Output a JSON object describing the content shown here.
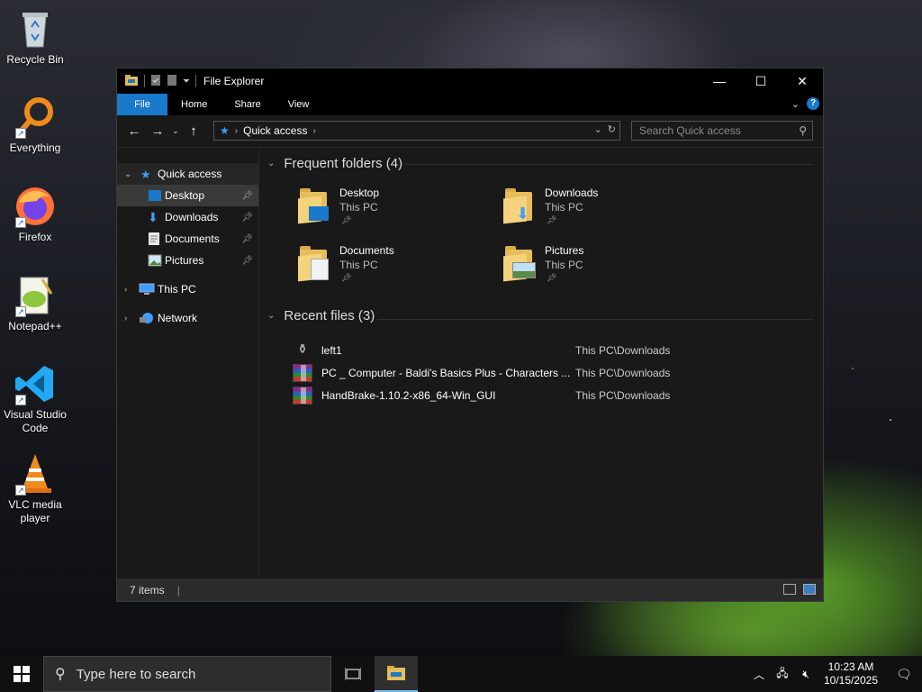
{
  "desktop": {
    "icons": [
      {
        "label": "Recycle Bin",
        "icon": "recycle-bin-icon"
      },
      {
        "label": "Everything",
        "icon": "everything-search-icon"
      },
      {
        "label": "Firefox",
        "icon": "firefox-icon"
      },
      {
        "label": "Notepad++",
        "icon": "notepad-plus-plus-icon"
      },
      {
        "label": "Visual Studio Code",
        "icon": "vscode-icon"
      },
      {
        "label": "VLC media player",
        "icon": "vlc-icon"
      }
    ]
  },
  "window": {
    "title": "File Explorer",
    "controls": {
      "minimize": "—",
      "maximize": "☐",
      "close": "✕"
    }
  },
  "ribbon": {
    "tabs": [
      "File",
      "Home",
      "Share",
      "View"
    ],
    "help": "?"
  },
  "address": {
    "path_label": "Quick access",
    "search_placeholder": "Search Quick access"
  },
  "nav": {
    "quick_access": "Quick access",
    "pinned": [
      "Desktop",
      "Downloads",
      "Documents",
      "Pictures"
    ],
    "this_pc": "This PC",
    "network": "Network"
  },
  "content": {
    "frequent_header": "Frequent folders (4)",
    "folders": [
      {
        "name": "Desktop",
        "location": "This PC"
      },
      {
        "name": "Downloads",
        "location": "This PC"
      },
      {
        "name": "Documents",
        "location": "This PC"
      },
      {
        "name": "Pictures",
        "location": "This PC"
      }
    ],
    "recent_header": "Recent files (3)",
    "files": [
      {
        "name": "left1",
        "path": "This PC\\Downloads"
      },
      {
        "name": "PC _ Computer - Baldi's Basics Plus - Characters ...",
        "path": "This PC\\Downloads"
      },
      {
        "name": "HandBrake-1.10.2-x86_64-Win_GUI",
        "path": "This PC\\Downloads"
      }
    ]
  },
  "status": {
    "items": "7 items"
  },
  "taskbar": {
    "search_placeholder": "Type here to search",
    "time": "10:23 AM",
    "date": "10/15/2025"
  },
  "colors": {
    "accent": "#1979ca",
    "window_bg": "#191919",
    "selection": "#3a3a3a"
  }
}
